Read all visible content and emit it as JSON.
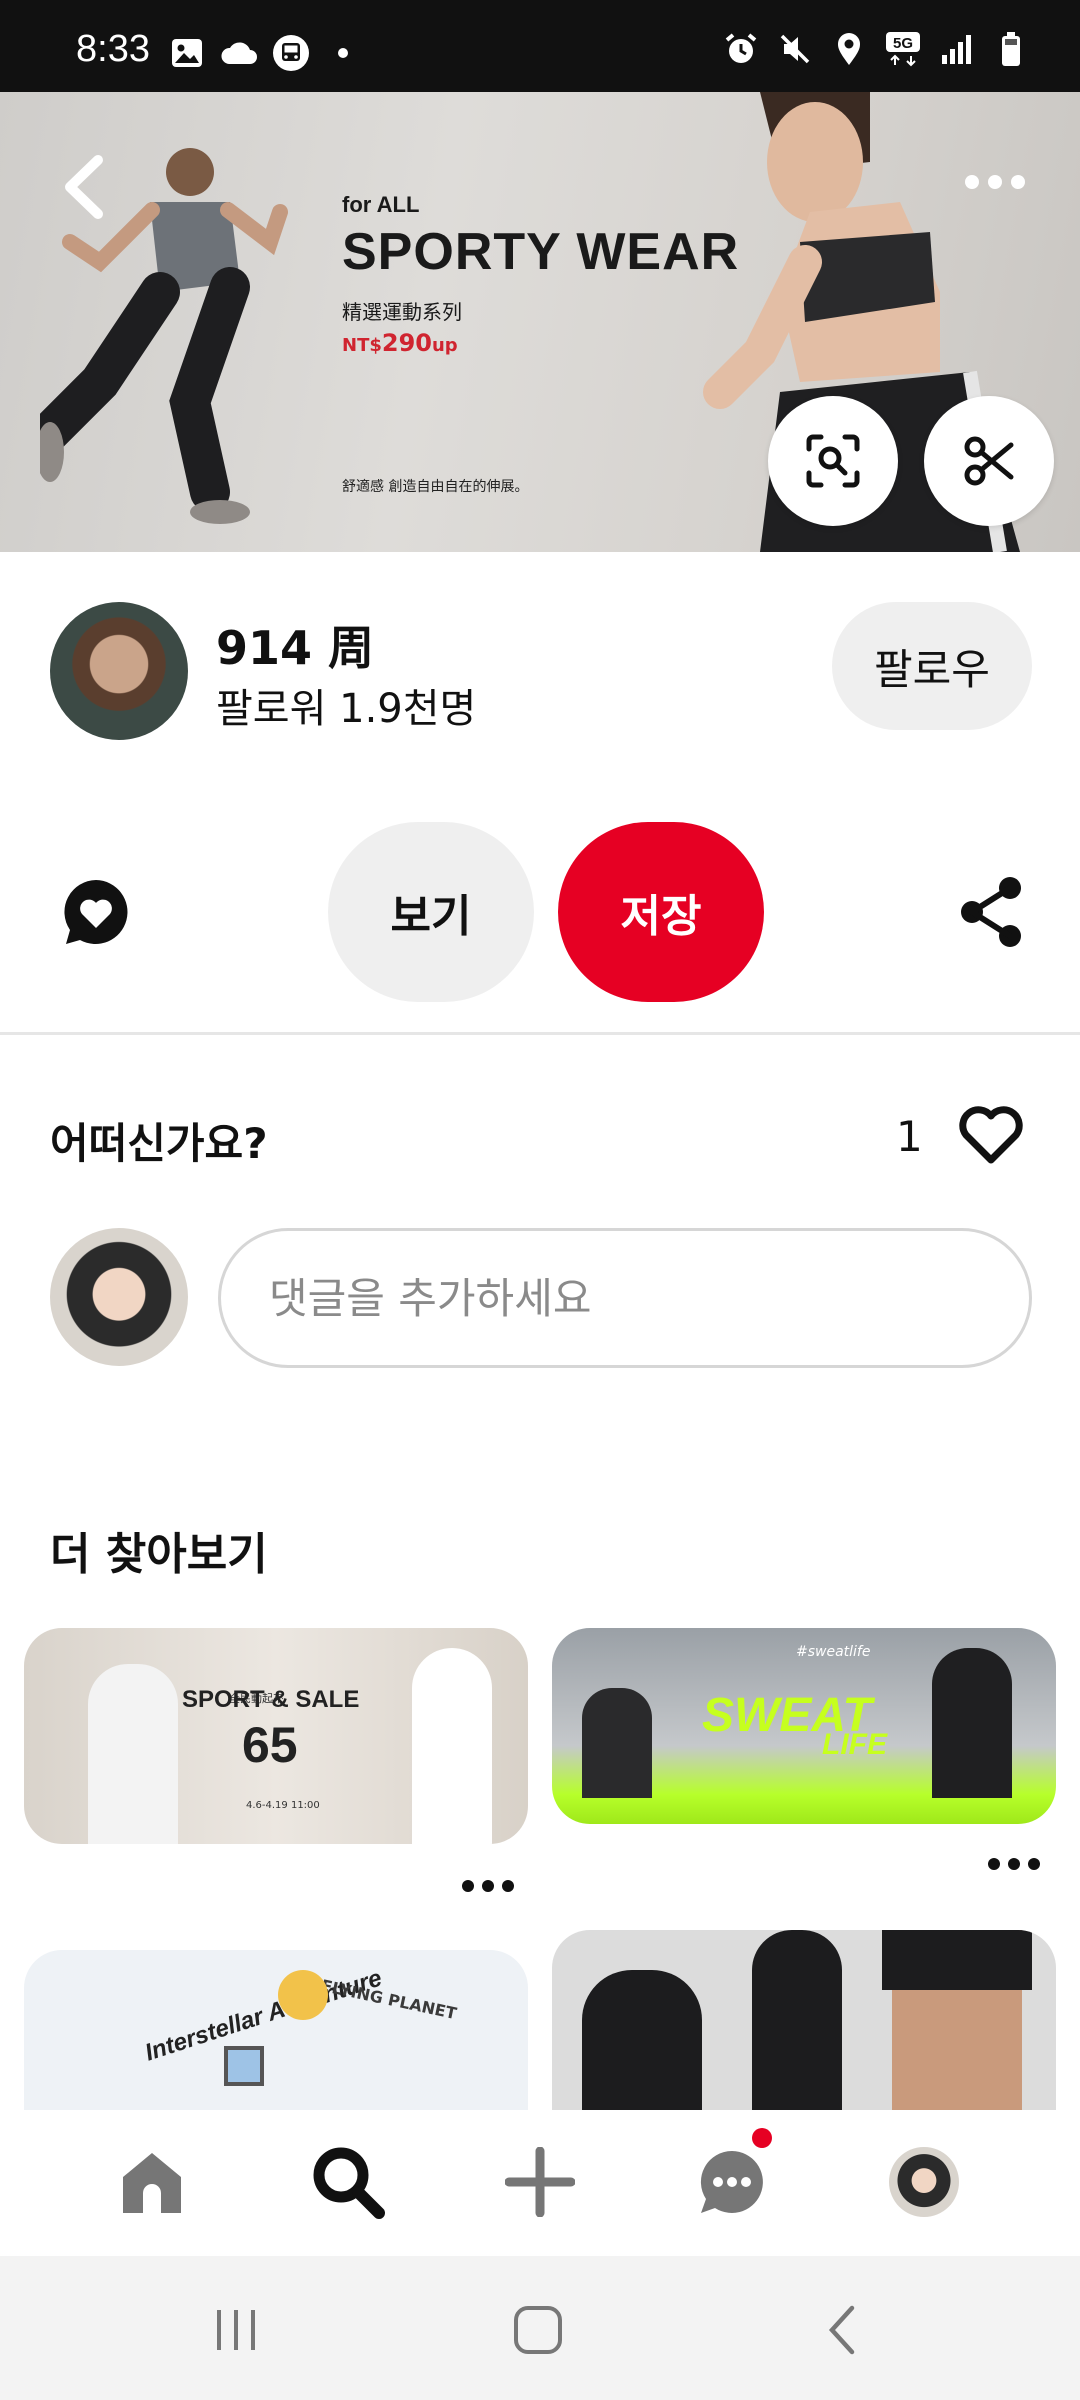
{
  "status_bar": {
    "time": "8:33",
    "left_icons": [
      "image-icon",
      "cloud-icon",
      "bus-icon",
      "dot-icon"
    ],
    "right_icons": [
      "alarm-icon",
      "mute-icon",
      "location-icon",
      "5g-icon",
      "signal-icon",
      "battery-icon"
    ],
    "network_label": "5G"
  },
  "hero": {
    "for_label": "for ALL",
    "title": "SPORTY WEAR",
    "subtitle": "精選運動系列",
    "price_prefix": "NT$",
    "price_value": "290",
    "price_suffix": "up",
    "footer_text": "舒適感 創造自由自在的伸展。"
  },
  "profile": {
    "name": "914 周",
    "followers": "팔로워 1.9천명",
    "follow_label": "팔로우"
  },
  "actions": {
    "view_label": "보기",
    "save_label": "저장"
  },
  "comments": {
    "question": "어떠신가요?",
    "like_count": "1",
    "placeholder": "댓글을 추가하세요"
  },
  "explore": {
    "title": "더 찾아보기",
    "pins": [
      {
        "headline": "SPORT & SALE",
        "big_number": "65",
        "small_label": "全民動起來",
        "date_text": "4.6-4.19 11:00"
      },
      {
        "headline": "SWEAT",
        "sub_headline": "LIFE",
        "tag": "#sweatlife"
      },
      {
        "headline": "Interstellar Adventure",
        "side_text": "FLYING PLANET"
      },
      {
        "headline": ""
      }
    ]
  },
  "bottom_nav": {
    "items": [
      "home-icon",
      "search-icon",
      "plus-icon",
      "chat-icon",
      "profile-avatar"
    ]
  },
  "colors": {
    "accent": "#e60023",
    "button_gray": "#efefef",
    "text": "#111111"
  }
}
